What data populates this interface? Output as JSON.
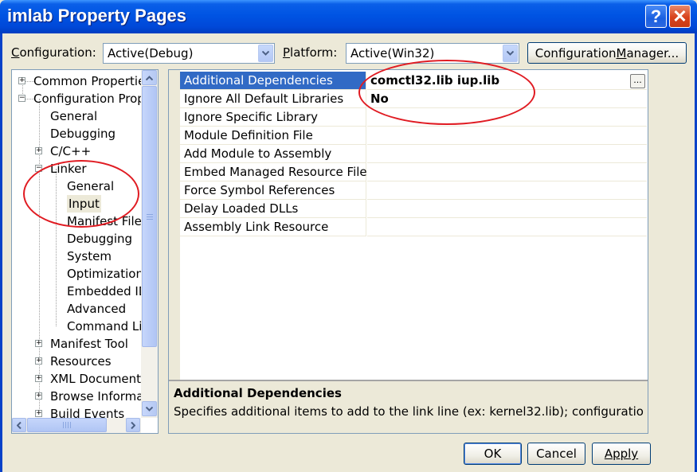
{
  "window": {
    "title": "imlab Property Pages",
    "help_label": "?",
    "close_label": "✕"
  },
  "config": {
    "configuration_label": "Configuration:",
    "configuration_value": "Active(Debug)",
    "platform_label": "Platform:",
    "platform_value": "Active(Win32)",
    "manager_button": "Configuration Manager..."
  },
  "tree": {
    "items": [
      {
        "label": "Common Propertie",
        "expander": "+"
      },
      {
        "label": "Configuration Prop",
        "expander": "−"
      },
      {
        "label": "General"
      },
      {
        "label": "Debugging"
      },
      {
        "label": "C/C++",
        "expander": "+"
      },
      {
        "label": "Linker",
        "expander": "−"
      },
      {
        "label": "General"
      },
      {
        "label": "Input"
      },
      {
        "label": "Manifest File"
      },
      {
        "label": "Debugging"
      },
      {
        "label": "System"
      },
      {
        "label": "Optimization"
      },
      {
        "label": "Embedded ID"
      },
      {
        "label": "Advanced"
      },
      {
        "label": "Command Lir"
      },
      {
        "label": "Manifest Tool",
        "expander": "+"
      },
      {
        "label": "Resources",
        "expander": "+"
      },
      {
        "label": "XML Document (",
        "expander": "+"
      },
      {
        "label": "Browse Informa",
        "expander": "+"
      },
      {
        "label": "Build Events",
        "expander": "+"
      }
    ]
  },
  "properties": [
    {
      "name": "Additional Dependencies",
      "value": "comctl32.lib iup.lib"
    },
    {
      "name": "Ignore All Default Libraries",
      "value": "No"
    },
    {
      "name": "Ignore Specific Library",
      "value": ""
    },
    {
      "name": "Module Definition File",
      "value": ""
    },
    {
      "name": "Add Module to Assembly",
      "value": ""
    },
    {
      "name": "Embed Managed Resource File",
      "value": ""
    },
    {
      "name": "Force Symbol References",
      "value": ""
    },
    {
      "name": "Delay Loaded DLLs",
      "value": ""
    },
    {
      "name": "Assembly Link Resource",
      "value": ""
    }
  ],
  "ellipsis_label": "...",
  "description": {
    "title": "Additional Dependencies",
    "text": "Specifies additional items to add to the link line (ex: kernel32.lib); configuration ..."
  },
  "buttons": {
    "ok": "OK",
    "cancel": "Cancel",
    "apply": "Apply"
  },
  "colors": {
    "selection": "#316ac5",
    "annotation": "#e01b22",
    "titlebar": "#0054e3"
  }
}
